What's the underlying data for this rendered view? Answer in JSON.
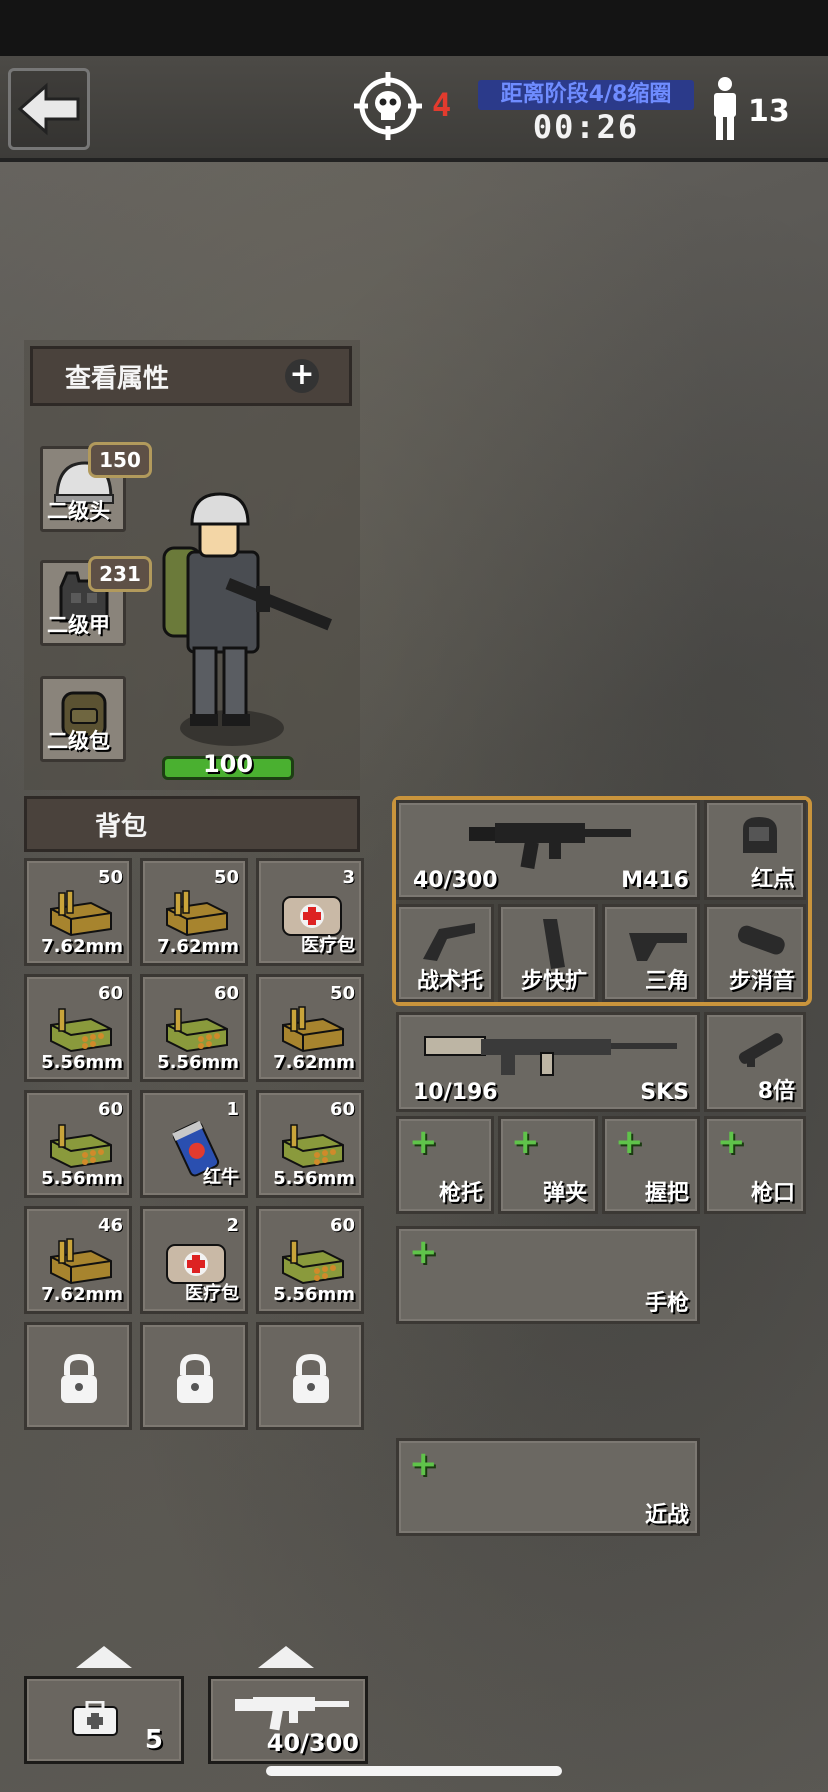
{
  "hud": {
    "kills": "4",
    "zone_text": "距离阶段4/8缩圈",
    "timer": "00:26",
    "players_alive": "13"
  },
  "attributes_panel": {
    "title": "查看属性",
    "plus": "+"
  },
  "gear": [
    {
      "label": "二级头",
      "durability": "150"
    },
    {
      "label": "二级甲",
      "durability": "231"
    },
    {
      "label": "二级包",
      "durability": ""
    }
  ],
  "health": "100",
  "backpack": {
    "title": "背包",
    "items": [
      {
        "qty": "50",
        "name": "7.62mm",
        "icon": "ammo-762-icon"
      },
      {
        "qty": "50",
        "name": "7.62mm",
        "icon": "ammo-762-icon"
      },
      {
        "qty": "3",
        "name": "医疗包",
        "icon": "medkit-icon"
      },
      {
        "qty": "60",
        "name": "5.56mm",
        "icon": "ammo-556-icon"
      },
      {
        "qty": "60",
        "name": "5.56mm",
        "icon": "ammo-556-icon"
      },
      {
        "qty": "50",
        "name": "7.62mm",
        "icon": "ammo-762-icon"
      },
      {
        "qty": "60",
        "name": "5.56mm",
        "icon": "ammo-556-icon"
      },
      {
        "qty": "1",
        "name": "红牛",
        "icon": "energy-drink-icon"
      },
      {
        "qty": "60",
        "name": "5.56mm",
        "icon": "ammo-556-icon"
      },
      {
        "qty": "46",
        "name": "7.62mm",
        "icon": "ammo-762-icon"
      },
      {
        "qty": "2",
        "name": "医疗包",
        "icon": "medkit-icon"
      },
      {
        "qty": "60",
        "name": "5.56mm",
        "icon": "ammo-556-icon"
      }
    ],
    "locked_slots": 3
  },
  "primary_weapon": {
    "ammo": "40/300",
    "name": "M416",
    "scope": "红点",
    "attachments": [
      "战术托",
      "步快扩",
      "三角",
      "步消音"
    ]
  },
  "secondary_weapon": {
    "ammo": "10/196",
    "name": "SKS",
    "scope": "8倍",
    "empty_slots": [
      "枪托",
      "弹夹",
      "握把",
      "枪口"
    ]
  },
  "pistol_slot": {
    "label": "手枪"
  },
  "melee_slot": {
    "label": "近战"
  },
  "quick_bar": {
    "medkit_count": "5",
    "weapon_ammo": "40/300"
  },
  "colors": {
    "accent_gold": "#c9943c",
    "plus_green": "#5fc34a",
    "kill_red": "#e23b2e",
    "health_green": "#4ab030"
  }
}
